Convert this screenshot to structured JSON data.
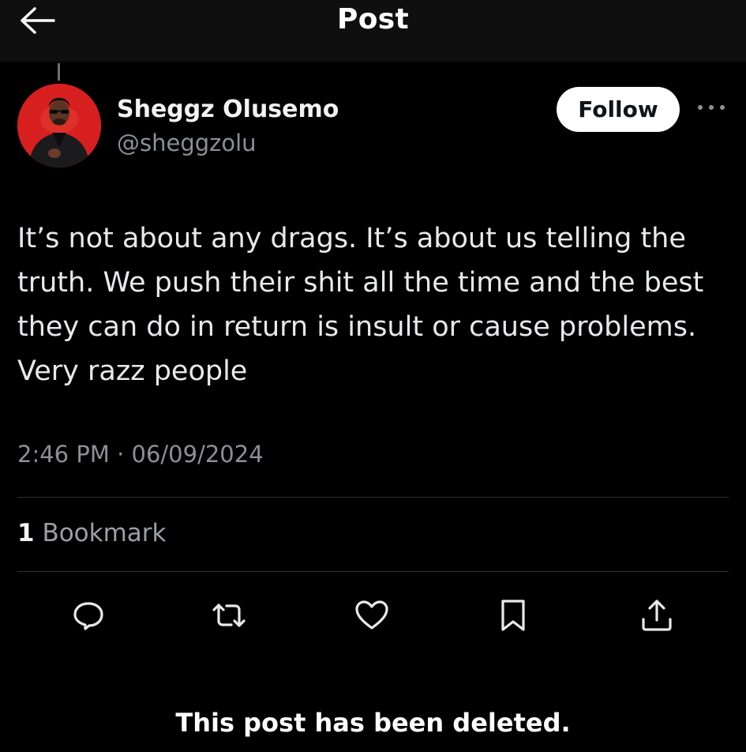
{
  "header": {
    "title": "Post",
    "back_icon": "arrow-left-icon"
  },
  "author": {
    "name": "Sheggz Olusemo",
    "handle": "@sheggzolu",
    "avatar_bg": "#d81f1f"
  },
  "follow_label": "Follow",
  "more_icon": "more-horizontal-icon",
  "post": {
    "text": "It’s not about any drags. It’s about us telling the truth. We push their shit all the time and the best they can do in return is insult or cause problems. Very razz people",
    "timestamp": "2:46 PM · 06/09/2024"
  },
  "bookmarks": {
    "count": "1",
    "label": "Bookmark"
  },
  "actions": [
    "reply-icon",
    "repost-icon",
    "like-icon",
    "bookmark-icon",
    "share-icon"
  ],
  "notice": "This post has been deleted."
}
